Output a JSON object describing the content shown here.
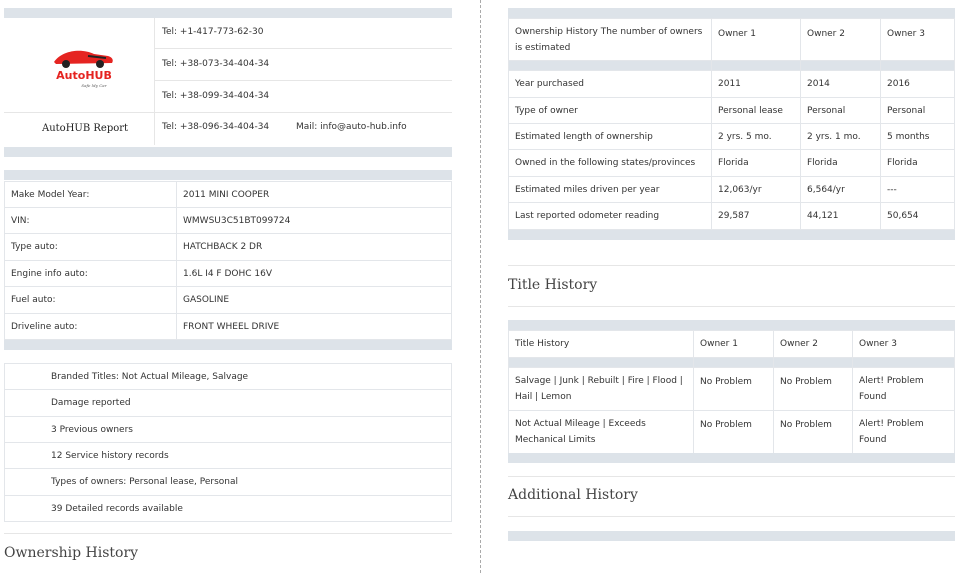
{
  "header": {
    "logo_text": "AutoHUB",
    "logo_tagline": "Safe My Car",
    "report_title": "AutoHUB Report",
    "phones": [
      "Tel: +1-417-773-62-30",
      "Tel: +38-073-34-404-34",
      "Tel: +38-099-34-404-34",
      "Tel: +38-096-34-404-34"
    ],
    "mail": "Mail: info@auto-hub.info"
  },
  "vehicle": [
    {
      "label": "Make Model Year:",
      "value": "2011 MINI COOPER"
    },
    {
      "label": "VIN:",
      "value": "WMWSU3C51BT099724"
    },
    {
      "label": "Type auto:",
      "value": "HATCHBACK 2 DR"
    },
    {
      "label": "Engine info auto:",
      "value": "1.6L I4 F DOHC 16V"
    },
    {
      "label": "Fuel auto:",
      "value": "GASOLINE"
    },
    {
      "label": "Driveline auto:",
      "value": "FRONT WHEEL DRIVE"
    }
  ],
  "summary": [
    "Branded Titles: Not Actual Mileage, Salvage",
    "Damage reported",
    "3 Previous owners",
    "12 Service history records",
    "Types of owners: Personal lease, Personal",
    "39 Detailed records available"
  ],
  "ownership_history_title": "Ownership History",
  "ownership": {
    "header": {
      "label": "Ownership History The number of owners is estimated",
      "owners": [
        "Owner 1",
        "Owner 2",
        "Owner 3"
      ]
    },
    "rows": [
      {
        "label": "Year purchased",
        "values": [
          "2011",
          "2014",
          "2016"
        ]
      },
      {
        "label": "Type of owner",
        "values": [
          "Personal lease",
          "Personal",
          "Personal"
        ]
      },
      {
        "label": "Estimated length of ownership",
        "values": [
          "2 yrs. 5 mo.",
          "2 yrs. 1 mo.",
          "5 months"
        ]
      },
      {
        "label": "Owned in the following states/provinces",
        "values": [
          "Florida",
          "Florida",
          "Florida"
        ]
      },
      {
        "label": "Estimated miles driven per year",
        "values": [
          "12,063/yr",
          "6,564/yr",
          "---"
        ]
      },
      {
        "label": "Last reported odometer reading",
        "values": [
          "29,587",
          "44,121",
          "50,654"
        ]
      }
    ]
  },
  "title_history_title": "Title History",
  "title_history": {
    "header": {
      "label": "Title History",
      "owners": [
        "Owner 1",
        "Owner 2",
        "Owner 3"
      ]
    },
    "rows": [
      {
        "label": "Salvage | Junk | Rebuilt | Fire | Flood | Hail | Lemon",
        "values": [
          "No Problem",
          "No Problem",
          "Alert! Problem Found"
        ]
      },
      {
        "label": "Not Actual Mileage | Exceeds Mechanical Limits",
        "values": [
          "No Problem",
          "No Problem",
          "Alert! Problem Found"
        ]
      }
    ]
  },
  "additional_history_title": "Additional History",
  "colors": {
    "bar": "#dde3e9",
    "logo_red": "#e52421",
    "logo_dark": "#222222"
  }
}
